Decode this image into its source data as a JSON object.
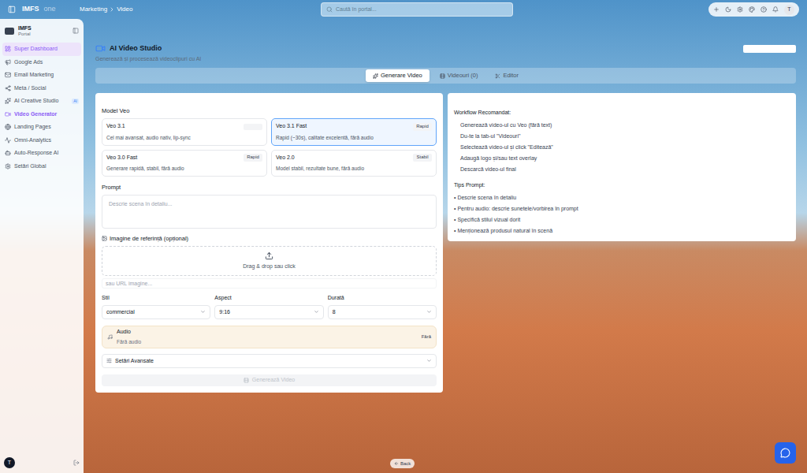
{
  "topbar": {
    "brand": "IMFS",
    "brand_suffix": "one",
    "breadcrumb": [
      "Marketing",
      "Video"
    ],
    "search": {
      "placeholder": "Caută în portal..."
    },
    "avatar": "T"
  },
  "sidebar": {
    "title": "IMFS",
    "subtitle": "Portal",
    "items": [
      {
        "label": "Super Dashboard",
        "selected": false,
        "hovered": true,
        "badge": ""
      },
      {
        "label": "Google Ads",
        "selected": false,
        "hovered": false,
        "badge": ""
      },
      {
        "label": "Email Marketing",
        "selected": false,
        "hovered": false,
        "badge": ""
      },
      {
        "label": "Meta / Social",
        "selected": false,
        "hovered": false,
        "badge": ""
      },
      {
        "label": "AI Creative Studio",
        "selected": false,
        "hovered": false,
        "badge": "AI"
      },
      {
        "label": "Video Generator",
        "selected": true,
        "hovered": false,
        "badge": ""
      },
      {
        "label": "Landing Pages",
        "selected": false,
        "hovered": false,
        "badge": ""
      },
      {
        "label": "Omni-Analytics",
        "selected": false,
        "hovered": false,
        "badge": ""
      },
      {
        "label": "Auto-Response AI",
        "selected": false,
        "hovered": false,
        "badge": ""
      },
      {
        "label": "Setări Global",
        "selected": false,
        "hovered": false,
        "badge": ""
      }
    ],
    "user_avatar": "T"
  },
  "page": {
    "title": "AI Video Studio",
    "subtitle": "Generează și procesează videoclipuri cu AI"
  },
  "tabs": [
    {
      "label": "Generare Video",
      "selected": true
    },
    {
      "label": "Videouri (0)",
      "selected": false
    },
    {
      "label": "Editor",
      "selected": false
    }
  ],
  "form": {
    "model_label": "Model Veo",
    "models": [
      {
        "name": "Veo 3.1",
        "description": "Cel mai avansat, audio nativ, lip-sync",
        "badge": "",
        "selected": false
      },
      {
        "name": "Veo 3.1 Fast",
        "description": "Rapid (~30s), calitate excelentă, fără audio",
        "badge": "Rapid",
        "selected": true
      },
      {
        "name": "Veo 3.0 Fast",
        "description": "Generare rapidă, stabil, fără audio",
        "badge": "Rapid",
        "selected": false
      },
      {
        "name": "Veo 2.0",
        "description": "Model stabil, rezultate bune, fără audio",
        "badge": "Stabil",
        "selected": false
      }
    ],
    "prompt_label": "Prompt",
    "prompt_placeholder": "Descrie scena în detaliu...",
    "reference_label": "Imagine de referință (opțional)",
    "dropzone_text": "Drag & drop sau click",
    "url_placeholder": "sau URL imagine...",
    "selects": [
      {
        "label": "Stil",
        "value": "commercial"
      },
      {
        "label": "Aspect",
        "value": "9:16"
      },
      {
        "label": "Durată",
        "value": "8"
      }
    ],
    "audio": {
      "title": "Audio",
      "value": "Fără audio",
      "badge": "Fără"
    },
    "advanced": {
      "label": "Setări Avansate",
      "expanded": false
    },
    "generate": {
      "label": "Generează Video",
      "disabled": true
    }
  },
  "workflow": {
    "title": "Workflow Recomandat:",
    "steps": [
      "Generează video-ul cu Veo (fără text)",
      "Du-te la tab-ul \"Videouri\"",
      "Selectează video-ul și click \"Editează\"",
      "Adaugă logo și/sau text overlay",
      "Descarcă video-ul final"
    ],
    "tips_title": "Tips Prompt:",
    "tips": [
      "• Descrie scena în detaliu",
      "• Pentru audio: descrie sunetele/vorbirea în prompt",
      "• Specifică stilul vizual dorit",
      "• Menționează produsul natural în scenă"
    ]
  },
  "back_button": "Back"
}
